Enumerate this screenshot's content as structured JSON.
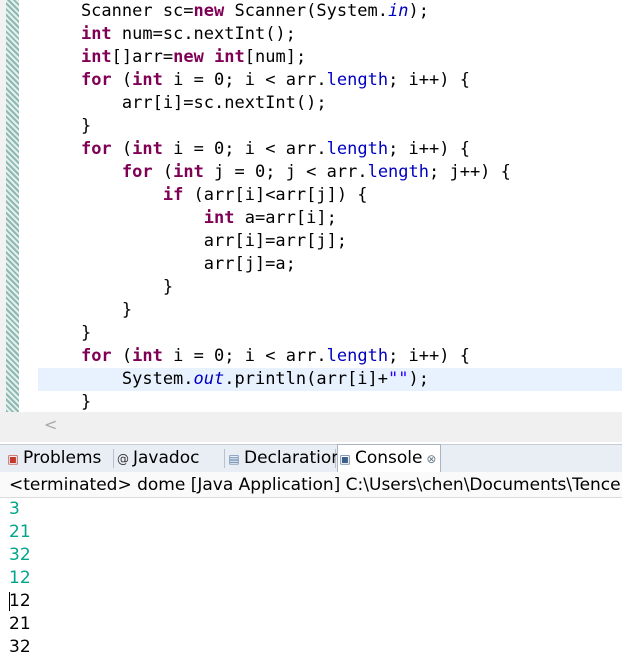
{
  "editor": {
    "lines": [
      [
        {
          "t": "    Scanner sc="
        },
        {
          "t": "new",
          "k": "kw"
        },
        {
          "t": " Scanner(System."
        },
        {
          "t": "in",
          "k": "sfld"
        },
        {
          "t": ");"
        }
      ],
      [
        {
          "t": "    "
        },
        {
          "t": "int",
          "k": "kw"
        },
        {
          "t": " num=sc.nextInt();"
        }
      ],
      [
        {
          "t": "    "
        },
        {
          "t": "int",
          "k": "kw"
        },
        {
          "t": "[]arr="
        },
        {
          "t": "new",
          "k": "kw"
        },
        {
          "t": " "
        },
        {
          "t": "int",
          "k": "kw"
        },
        {
          "t": "[num];"
        }
      ],
      [
        {
          "t": "    "
        },
        {
          "t": "for",
          "k": "kw"
        },
        {
          "t": " ("
        },
        {
          "t": "int",
          "k": "kw"
        },
        {
          "t": " i = 0; i < arr."
        },
        {
          "t": "length",
          "k": "fld"
        },
        {
          "t": "; i++) {"
        }
      ],
      [
        {
          "t": "        arr[i]=sc.nextInt();"
        }
      ],
      [
        {
          "t": "    }"
        }
      ],
      [
        {
          "t": "    "
        },
        {
          "t": "for",
          "k": "kw"
        },
        {
          "t": " ("
        },
        {
          "t": "int",
          "k": "kw"
        },
        {
          "t": " i = 0; i < arr."
        },
        {
          "t": "length",
          "k": "fld"
        },
        {
          "t": "; i++) {"
        }
      ],
      [
        {
          "t": "        "
        },
        {
          "t": "for",
          "k": "kw"
        },
        {
          "t": " ("
        },
        {
          "t": "int",
          "k": "kw"
        },
        {
          "t": " j = 0; j < arr."
        },
        {
          "t": "length",
          "k": "fld"
        },
        {
          "t": "; j++) {"
        }
      ],
      [
        {
          "t": "            "
        },
        {
          "t": "if",
          "k": "kw"
        },
        {
          "t": " (arr[i]<arr[j]) {"
        }
      ],
      [
        {
          "t": "                "
        },
        {
          "t": "int",
          "k": "kw"
        },
        {
          "t": " a=arr[i];"
        }
      ],
      [
        {
          "t": "                arr[i]=arr[j];"
        }
      ],
      [
        {
          "t": "                arr[j]=a;"
        }
      ],
      [
        {
          "t": "            }"
        }
      ],
      [
        {
          "t": "        }"
        }
      ],
      [
        {
          "t": "    }"
        }
      ],
      [
        {
          "t": "    "
        },
        {
          "t": "for",
          "k": "kw"
        },
        {
          "t": " ("
        },
        {
          "t": "int",
          "k": "kw"
        },
        {
          "t": " i = 0; i < arr."
        },
        {
          "t": "length",
          "k": "fld"
        },
        {
          "t": "; i++) {"
        }
      ],
      [
        {
          "t": "        System."
        },
        {
          "t": "out",
          "k": "sfld"
        },
        {
          "t": ".println(arr[i]+"
        },
        {
          "t": "\"\"",
          "k": "str"
        },
        {
          "t": ");"
        }
      ],
      [
        {
          "t": "    }"
        }
      ]
    ],
    "current_line": 16,
    "scroll_left_icon": "chevron-left-icon"
  },
  "tabs": [
    {
      "label": "Problems",
      "icon": "problems-icon",
      "glyph": "▣",
      "color": "#c0392b"
    },
    {
      "label": "Javadoc",
      "icon": "at-icon",
      "glyph": "@",
      "color": "#333333"
    },
    {
      "label": "Declaration",
      "icon": "declaration-icon",
      "glyph": "▤",
      "color": "#5b7fa6"
    },
    {
      "label": "Console",
      "icon": "console-icon",
      "glyph": "▣",
      "color": "#3d5f8a",
      "active": true
    }
  ],
  "console": {
    "header": "<terminated> dome [Java Application] C:\\Users\\chen\\Documents\\Tencent",
    "output": [
      {
        "text": "3",
        "kind": "input"
      },
      {
        "text": "21",
        "kind": "input"
      },
      {
        "text": "32",
        "kind": "input"
      },
      {
        "text": "12",
        "kind": "input"
      },
      {
        "text": "12",
        "kind": "output"
      },
      {
        "text": "21",
        "kind": "output"
      },
      {
        "text": "32",
        "kind": "output"
      }
    ],
    "colors": {
      "input": "#00a58c",
      "output": "#000000"
    }
  }
}
